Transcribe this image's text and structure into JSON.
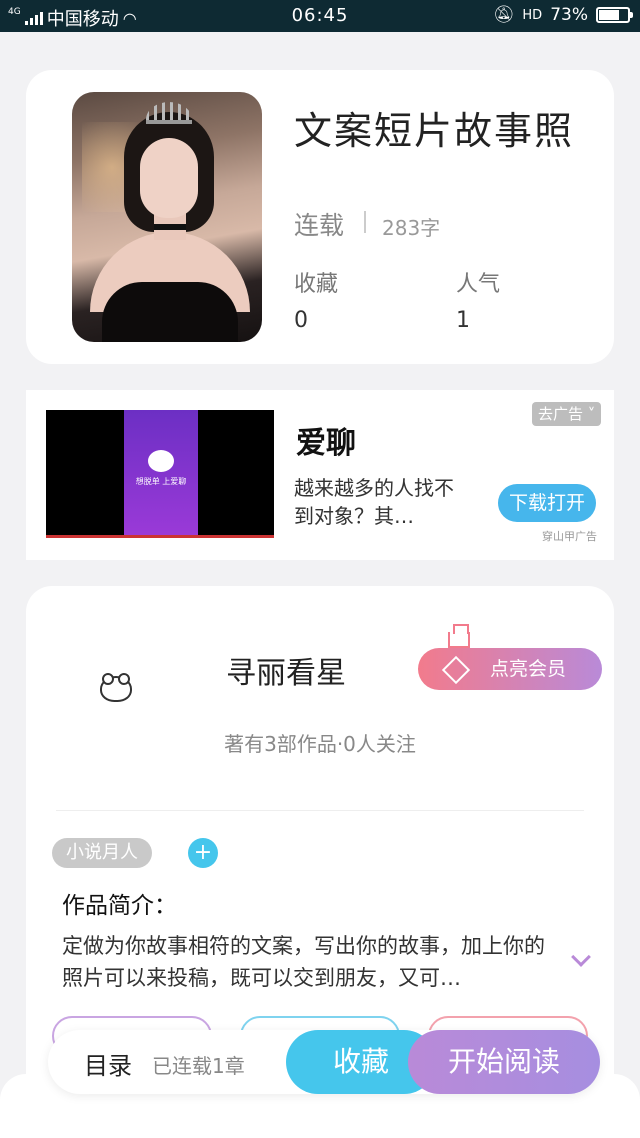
{
  "status_bar": {
    "network": "4G",
    "carrier": "中国移动",
    "time": "06:45",
    "hd": "HD",
    "battery": "73%",
    "battery_level": 0.73
  },
  "book": {
    "title": "文案短片故事照",
    "status": "连载",
    "word_count": "283字",
    "favorites_label": "收藏",
    "favorites_value": "0",
    "popularity_label": "人气",
    "popularity_value": "1"
  },
  "ad": {
    "title": "爱聊",
    "description": "越来越多的人找不到对象？其…",
    "tag": "去广告",
    "cta": "下载打开",
    "source": "穿山甲广告",
    "video_slogan": "想脱单 上爱聊"
  },
  "author": {
    "name": "寻丽看星",
    "vip_label": "点亮会员",
    "stats": "著有3部作品·0人关注",
    "tag": "小说月人",
    "add_symbol": "+",
    "intro_label": "作品简介：",
    "intro_text": "定做为你故事相符的文案，写出你的故事，加上你的照片可以来投稿，既可以交到朋友，又可…"
  },
  "bottom_bar": {
    "toc_label": "目录",
    "serial_label": "已连载1章",
    "favorite_label": "收藏",
    "read_label": "开始阅读"
  },
  "colors": {
    "accent_blue": "#45c6ec",
    "accent_purple": "#b98ad8",
    "accent_pink": "#f27b8c"
  }
}
